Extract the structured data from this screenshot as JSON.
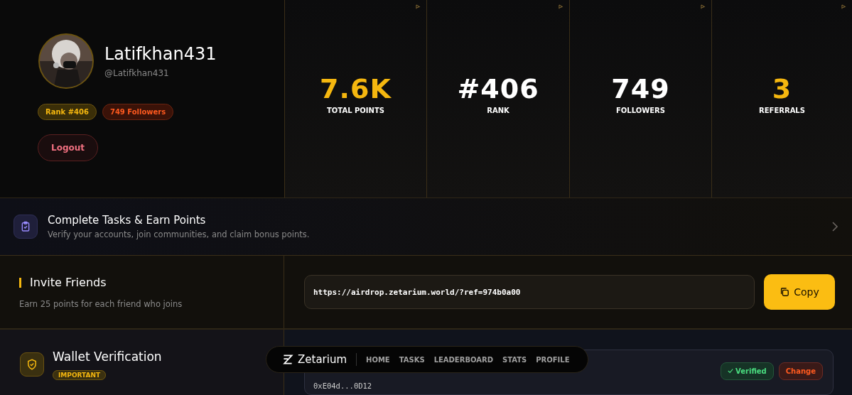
{
  "profile": {
    "name": "Latifkhan431",
    "handle": "@Latifkhan431",
    "badges": [
      {
        "kind": "rank",
        "label": "Rank #406"
      },
      {
        "kind": "followers",
        "label": "749 Followers"
      }
    ],
    "logout": "Logout"
  },
  "stats": [
    {
      "value": "7.6K",
      "label": "TOTAL POINTS",
      "color": "#f5b70f"
    },
    {
      "value": "#406",
      "label": "RANK",
      "color": "#ffffff"
    },
    {
      "value": "749",
      "label": "FOLLOWERS",
      "color": "#ffffff"
    },
    {
      "value": "3",
      "label": "REFERRALS",
      "color": "#f5b70f"
    }
  ],
  "tasks_banner": {
    "title": "Complete Tasks & Earn Points",
    "subtitle": "Verify your accounts, join communities, and claim bonus points."
  },
  "invite": {
    "title": "Invite Friends",
    "subtitle": "Earn 25 points for each friend who joins",
    "link": "https://airdrop.zetarium.world/?ref=974b0a00",
    "copy": "Copy"
  },
  "wallet": {
    "title": "Wallet Verification",
    "tag": "IMPORTANT",
    "address": "0xE04d...0D12",
    "verified": "Verified",
    "change": "Change"
  },
  "nav": {
    "brand": "Zetarium",
    "items": [
      {
        "label": "HOME",
        "selected": false
      },
      {
        "label": "TASKS",
        "selected": false
      },
      {
        "label": "LEADERBOARD",
        "selected": false
      },
      {
        "label": "STATS",
        "selected": false
      },
      {
        "label": "PROFILE",
        "selected": false
      }
    ]
  }
}
